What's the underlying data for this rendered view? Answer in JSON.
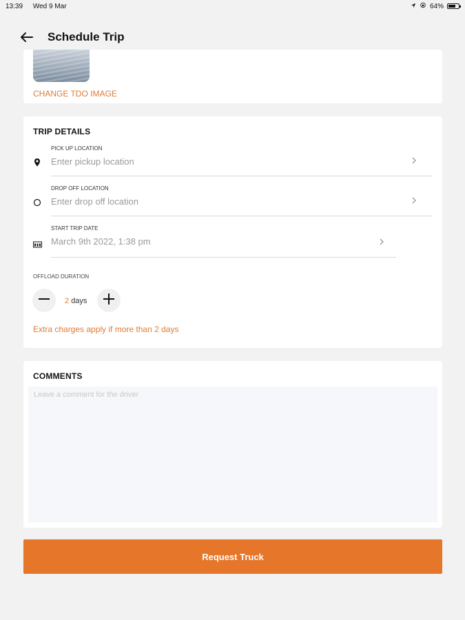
{
  "status_bar": {
    "time": "13:39",
    "date": "Wed 9 Mar",
    "battery": "64%"
  },
  "header": {
    "title": "Schedule Trip",
    "back_icon": "arrow-left-icon"
  },
  "tdo": {
    "change_label": "CHANGE TDO IMAGE"
  },
  "trip_details": {
    "title": "TRIP DETAILS",
    "pickup": {
      "label": "PICK UP LOCATION",
      "placeholder": "Enter pickup location",
      "icon": "map-pin-icon"
    },
    "dropoff": {
      "label": "DROP OFF LOCATION",
      "placeholder": "Enter drop off location",
      "icon": "circle-icon"
    },
    "start_date": {
      "label": "START TRIP DATE",
      "value": "March 9th 2022, 1:38 pm",
      "icon": "calendar-icon"
    },
    "offload": {
      "label": "OFFLOAD DURATION",
      "value": "2",
      "unit": "days",
      "note": "Extra charges apply if more than 2 days"
    }
  },
  "comments": {
    "title": "COMMENTS",
    "placeholder": "Leave a comment for the driver",
    "value": ""
  },
  "actions": {
    "request_label": "Request Truck"
  },
  "colors": {
    "accent": "#e5762a",
    "background": "#f2f2f2"
  }
}
